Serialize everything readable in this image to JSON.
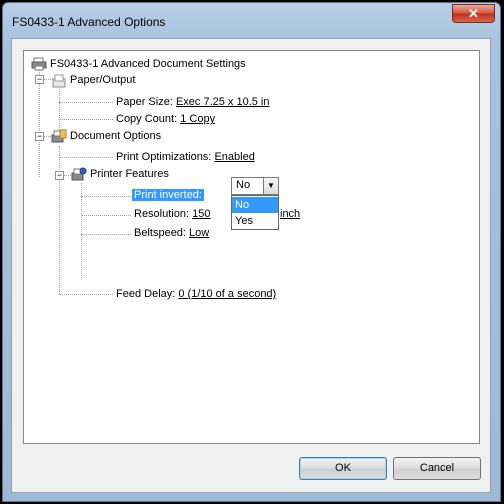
{
  "window": {
    "title": "FS0433-1 Advanced Options",
    "close_glyph": "✕"
  },
  "tree": {
    "root": "FS0433-1 Advanced Document Settings",
    "paper_output": "Paper/Output",
    "paper_size_label": "Paper Size:",
    "paper_size_value": "Exec 7.25 x 10.5 in",
    "copy_count_label": "Copy Count:",
    "copy_count_value": "1 Copy",
    "document_options": "Document Options",
    "print_opt_label": "Print Optimizations:",
    "print_opt_value": "Enabled",
    "printer_features": "Printer Features",
    "print_inverted_label": "Print inverted:",
    "resolution_label": "Resolution:",
    "resolution_value_start": "150",
    "resolution_value_end": "inch",
    "beltspeed_label": "Beltspeed:",
    "beltspeed_value": "Low",
    "feed_delay_label": "Feed Delay:",
    "feed_delay_value": "0  (1/10 of a second)"
  },
  "combo": {
    "selected": "No",
    "options": [
      "No",
      "Yes"
    ],
    "arrow": "▼"
  },
  "buttons": {
    "ok": "OK",
    "cancel": "Cancel"
  },
  "icons": [
    "printer-icon",
    "paper-icon",
    "document-options-icon",
    "printer-features-icon"
  ]
}
